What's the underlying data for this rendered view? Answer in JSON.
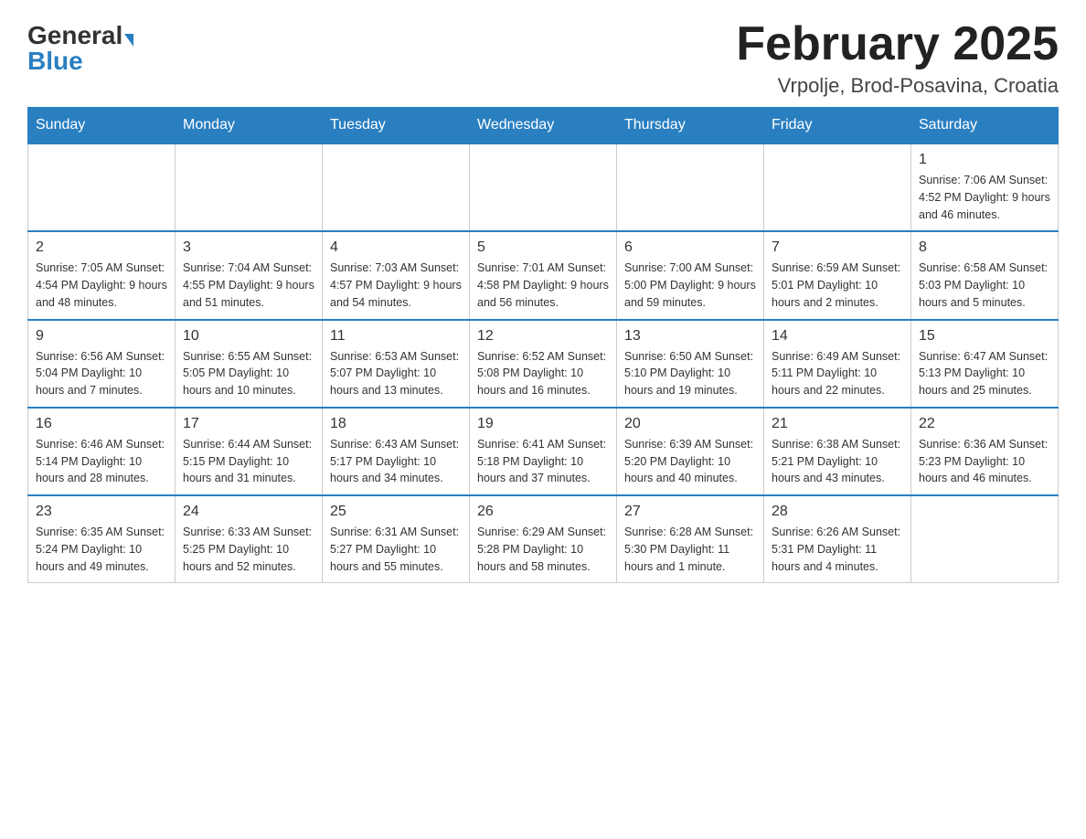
{
  "header": {
    "logo_general": "General",
    "logo_blue": "Blue",
    "month_title": "February 2025",
    "location": "Vrpolje, Brod-Posavina, Croatia"
  },
  "weekdays": [
    "Sunday",
    "Monday",
    "Tuesday",
    "Wednesday",
    "Thursday",
    "Friday",
    "Saturday"
  ],
  "weeks": [
    [
      {
        "day": "",
        "info": ""
      },
      {
        "day": "",
        "info": ""
      },
      {
        "day": "",
        "info": ""
      },
      {
        "day": "",
        "info": ""
      },
      {
        "day": "",
        "info": ""
      },
      {
        "day": "",
        "info": ""
      },
      {
        "day": "1",
        "info": "Sunrise: 7:06 AM\nSunset: 4:52 PM\nDaylight: 9 hours and 46 minutes."
      }
    ],
    [
      {
        "day": "2",
        "info": "Sunrise: 7:05 AM\nSunset: 4:54 PM\nDaylight: 9 hours and 48 minutes."
      },
      {
        "day": "3",
        "info": "Sunrise: 7:04 AM\nSunset: 4:55 PM\nDaylight: 9 hours and 51 minutes."
      },
      {
        "day": "4",
        "info": "Sunrise: 7:03 AM\nSunset: 4:57 PM\nDaylight: 9 hours and 54 minutes."
      },
      {
        "day": "5",
        "info": "Sunrise: 7:01 AM\nSunset: 4:58 PM\nDaylight: 9 hours and 56 minutes."
      },
      {
        "day": "6",
        "info": "Sunrise: 7:00 AM\nSunset: 5:00 PM\nDaylight: 9 hours and 59 minutes."
      },
      {
        "day": "7",
        "info": "Sunrise: 6:59 AM\nSunset: 5:01 PM\nDaylight: 10 hours and 2 minutes."
      },
      {
        "day": "8",
        "info": "Sunrise: 6:58 AM\nSunset: 5:03 PM\nDaylight: 10 hours and 5 minutes."
      }
    ],
    [
      {
        "day": "9",
        "info": "Sunrise: 6:56 AM\nSunset: 5:04 PM\nDaylight: 10 hours and 7 minutes."
      },
      {
        "day": "10",
        "info": "Sunrise: 6:55 AM\nSunset: 5:05 PM\nDaylight: 10 hours and 10 minutes."
      },
      {
        "day": "11",
        "info": "Sunrise: 6:53 AM\nSunset: 5:07 PM\nDaylight: 10 hours and 13 minutes."
      },
      {
        "day": "12",
        "info": "Sunrise: 6:52 AM\nSunset: 5:08 PM\nDaylight: 10 hours and 16 minutes."
      },
      {
        "day": "13",
        "info": "Sunrise: 6:50 AM\nSunset: 5:10 PM\nDaylight: 10 hours and 19 minutes."
      },
      {
        "day": "14",
        "info": "Sunrise: 6:49 AM\nSunset: 5:11 PM\nDaylight: 10 hours and 22 minutes."
      },
      {
        "day": "15",
        "info": "Sunrise: 6:47 AM\nSunset: 5:13 PM\nDaylight: 10 hours and 25 minutes."
      }
    ],
    [
      {
        "day": "16",
        "info": "Sunrise: 6:46 AM\nSunset: 5:14 PM\nDaylight: 10 hours and 28 minutes."
      },
      {
        "day": "17",
        "info": "Sunrise: 6:44 AM\nSunset: 5:15 PM\nDaylight: 10 hours and 31 minutes."
      },
      {
        "day": "18",
        "info": "Sunrise: 6:43 AM\nSunset: 5:17 PM\nDaylight: 10 hours and 34 minutes."
      },
      {
        "day": "19",
        "info": "Sunrise: 6:41 AM\nSunset: 5:18 PM\nDaylight: 10 hours and 37 minutes."
      },
      {
        "day": "20",
        "info": "Sunrise: 6:39 AM\nSunset: 5:20 PM\nDaylight: 10 hours and 40 minutes."
      },
      {
        "day": "21",
        "info": "Sunrise: 6:38 AM\nSunset: 5:21 PM\nDaylight: 10 hours and 43 minutes."
      },
      {
        "day": "22",
        "info": "Sunrise: 6:36 AM\nSunset: 5:23 PM\nDaylight: 10 hours and 46 minutes."
      }
    ],
    [
      {
        "day": "23",
        "info": "Sunrise: 6:35 AM\nSunset: 5:24 PM\nDaylight: 10 hours and 49 minutes."
      },
      {
        "day": "24",
        "info": "Sunrise: 6:33 AM\nSunset: 5:25 PM\nDaylight: 10 hours and 52 minutes."
      },
      {
        "day": "25",
        "info": "Sunrise: 6:31 AM\nSunset: 5:27 PM\nDaylight: 10 hours and 55 minutes."
      },
      {
        "day": "26",
        "info": "Sunrise: 6:29 AM\nSunset: 5:28 PM\nDaylight: 10 hours and 58 minutes."
      },
      {
        "day": "27",
        "info": "Sunrise: 6:28 AM\nSunset: 5:30 PM\nDaylight: 11 hours and 1 minute."
      },
      {
        "day": "28",
        "info": "Sunrise: 6:26 AM\nSunset: 5:31 PM\nDaylight: 11 hours and 4 minutes."
      },
      {
        "day": "",
        "info": ""
      }
    ]
  ]
}
